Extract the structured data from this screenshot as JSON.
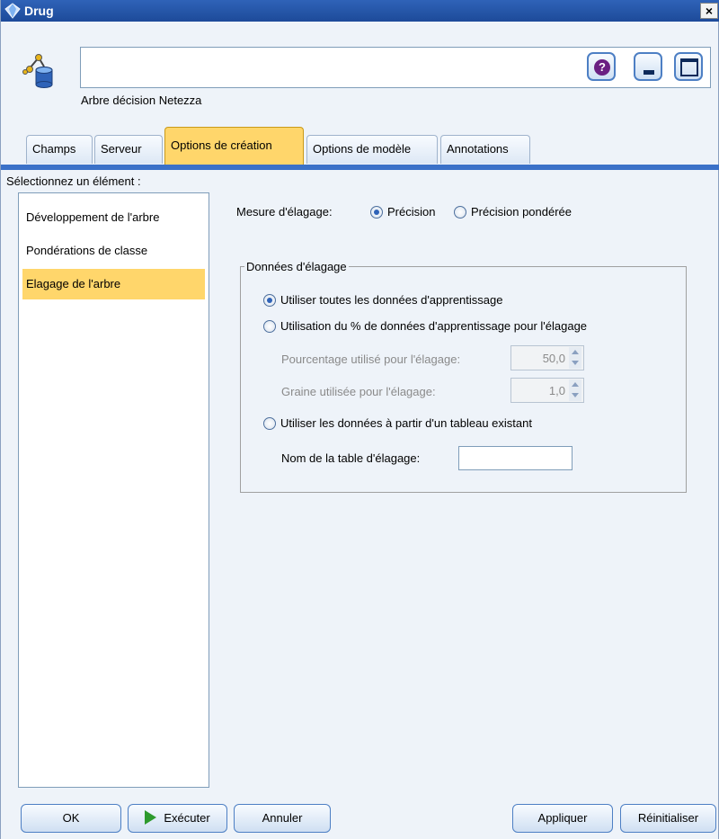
{
  "window": {
    "title": "Drug",
    "close_glyph": "×"
  },
  "header": {
    "node_name_value": "",
    "node_type_label": "Arbre décision Netezza",
    "help_glyph": "?"
  },
  "tabs": [
    {
      "label": "Champs",
      "active": false
    },
    {
      "label": "Serveur",
      "active": false
    },
    {
      "label": "Options de création",
      "active": true
    },
    {
      "label": "Options de modèle",
      "active": false
    },
    {
      "label": "Annotations",
      "active": false
    }
  ],
  "left_panel": {
    "select_label": "Sélectionnez un élément :",
    "items": [
      {
        "label": "Développement de l'arbre",
        "selected": false
      },
      {
        "label": "Pondérations de classe",
        "selected": false
      },
      {
        "label": "Elagage de l'arbre",
        "selected": true
      }
    ]
  },
  "pruning_measure": {
    "label": "Mesure d'élagage:",
    "options": [
      {
        "label": "Précision",
        "checked": true
      },
      {
        "label": "Précision pondérée",
        "checked": false
      }
    ]
  },
  "pruning_data": {
    "group_title": "Données d'élagage",
    "option_all": "Utiliser toutes les données d'apprentissage",
    "option_all_checked": true,
    "option_percent": "Utilisation du % de données d'apprentissage pour l'élagage",
    "option_percent_checked": false,
    "percent_label": "Pourcentage utilisé pour l'élagage:",
    "percent_value": "50,0",
    "seed_label": "Graine utilisée pour l'élagage:",
    "seed_value": "1,0",
    "option_table": "Utiliser les données à partir d'un tableau existant",
    "option_table_checked": false,
    "table_label": "Nom de la table d'élagage:",
    "table_value": ""
  },
  "buttons": {
    "ok": "OK",
    "run": "Exécuter",
    "cancel": "Annuler",
    "apply": "Appliquer",
    "reset": "Réinitialiser"
  },
  "colors": {
    "titlebar": "#2f63b8",
    "accent_tab": "#ffd66b",
    "tab_underline": "#3b71c8",
    "run_icon": "#2d9a2d"
  },
  "icons": {
    "title": "diamond-node-icon",
    "node": "decision-tree-database-icon",
    "run": "play-icon"
  }
}
